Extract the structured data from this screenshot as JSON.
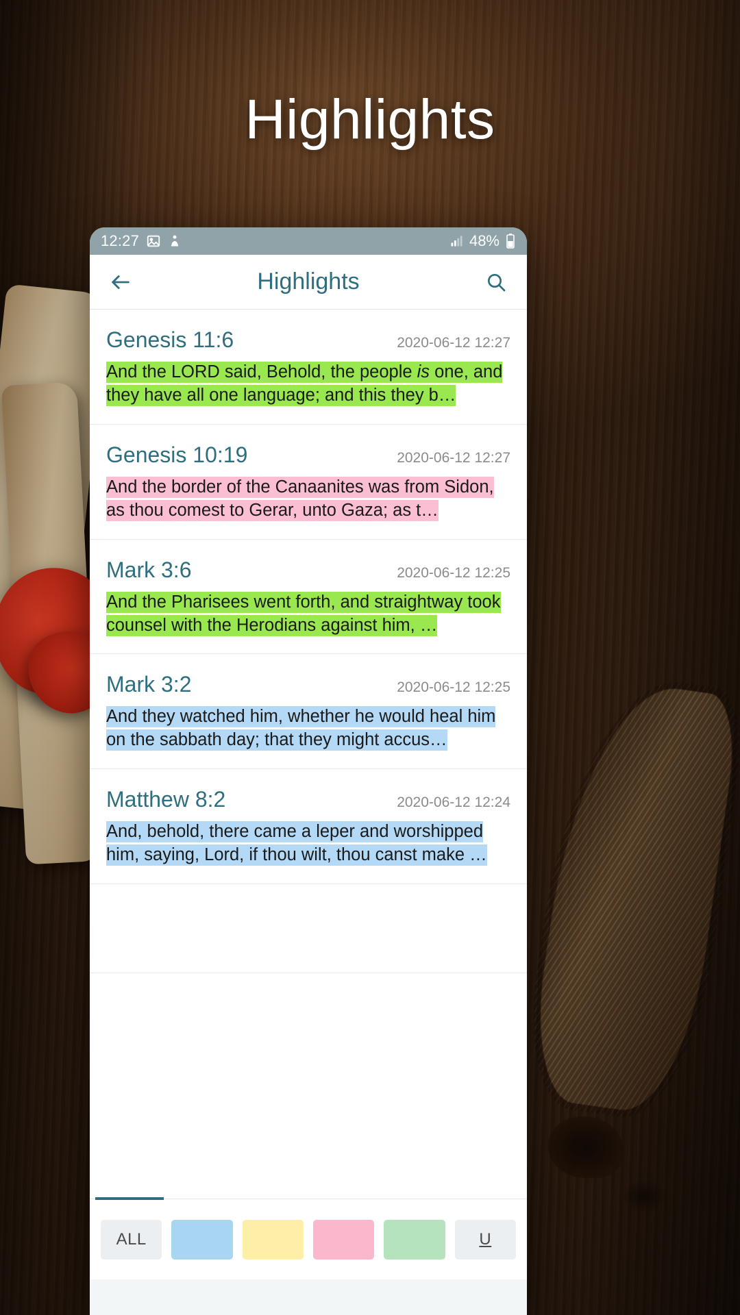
{
  "poster": {
    "title": "Highlights"
  },
  "phone": {
    "statusbar": {
      "time": "12:27",
      "icons": [
        "image-icon",
        "app-icon"
      ],
      "signal_icon": "signal-bars-icon",
      "battery_text": "48%",
      "battery_icon": "battery-icon"
    },
    "appbar": {
      "back_icon": "arrow-left-icon",
      "title": "Highlights",
      "search_icon": "search-icon"
    },
    "items": [
      {
        "reference": "Genesis 11:6",
        "timestamp": "2020-06-12 12:27",
        "color": "green",
        "text_parts": [
          {
            "text": "And the LORD said, Behold, the people ",
            "italic": false
          },
          {
            "text": "is",
            "italic": true
          },
          {
            "text": " one, and they have all one language; and this they b…",
            "italic": false
          }
        ]
      },
      {
        "reference": "Genesis 10:19",
        "timestamp": "2020-06-12 12:27",
        "color": "pink",
        "text_parts": [
          {
            "text": "And the border of the Canaanites was from Sidon, as thou comest to Gerar, unto Gaza; as t…",
            "italic": false
          }
        ]
      },
      {
        "reference": "Mark 3:6",
        "timestamp": "2020-06-12 12:25",
        "color": "green",
        "text_parts": [
          {
            "text": "And the Pharisees went forth, and straightway took counsel with the Herodians against him, …",
            "italic": false
          }
        ]
      },
      {
        "reference": "Mark 3:2",
        "timestamp": "2020-06-12 12:25",
        "color": "blue",
        "text_parts": [
          {
            "text": "And they watched him, whether he would heal him on the sabbath day; that they might accus…",
            "italic": false
          }
        ]
      },
      {
        "reference": "Matthew 8:2",
        "timestamp": "2020-06-12 12:24",
        "color": "blue",
        "text_parts": [
          {
            "text": "And, behold, there came a leper and worshipped him, saying, Lord, if thou wilt, thou canst make …",
            "italic": false
          }
        ]
      }
    ],
    "filters": [
      {
        "label": "ALL",
        "style": "all",
        "name": "filter-all"
      },
      {
        "label": "",
        "style": "blue",
        "name": "filter-blue"
      },
      {
        "label": "",
        "style": "yellow",
        "name": "filter-yellow"
      },
      {
        "label": "",
        "style": "pink",
        "name": "filter-pink"
      },
      {
        "label": "",
        "style": "green",
        "name": "filter-green"
      },
      {
        "label": "U",
        "style": "u",
        "name": "filter-underline"
      }
    ]
  },
  "colors": {
    "accent": "#2e6e7e",
    "statusbar": "#8fa3a8",
    "highlight_green": "#9ae84f",
    "highlight_pink": "#fcbed2",
    "highlight_blue": "#b3d9f6",
    "highlight_yellow": "#fdeea8"
  }
}
